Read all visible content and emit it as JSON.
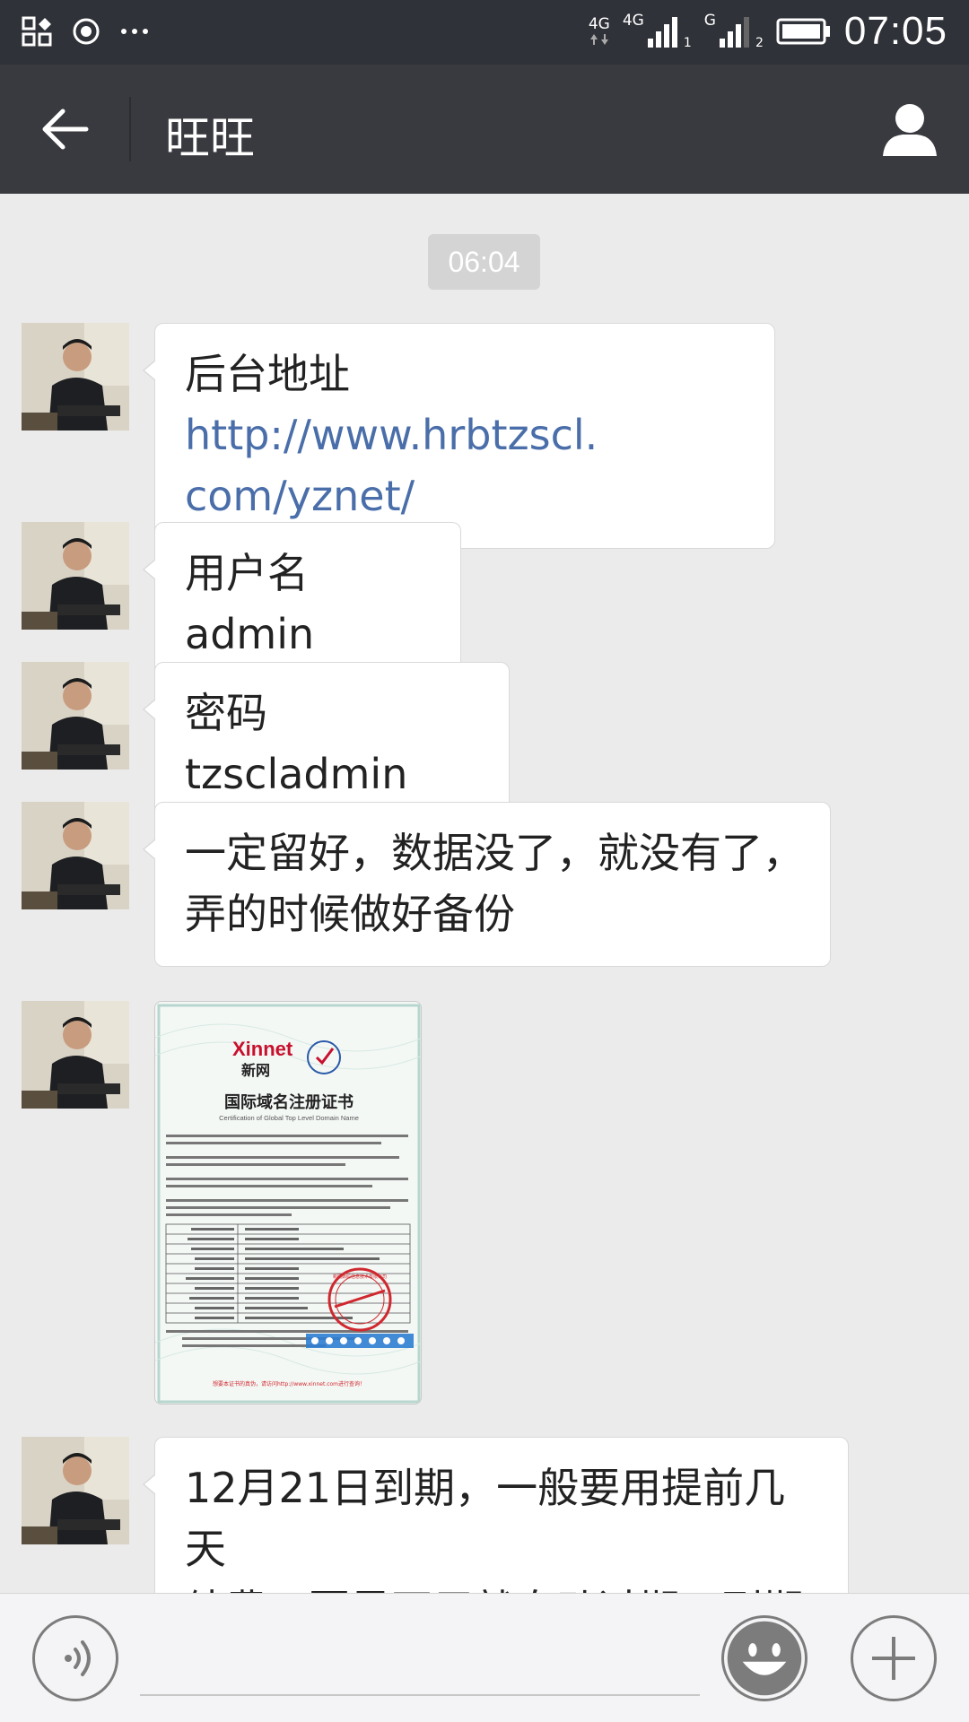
{
  "status_bar": {
    "network_1": "4G",
    "network_2": "4G",
    "sim1_index": "1",
    "network_3": "G",
    "sim2_index": "2",
    "time": "07:05"
  },
  "header": {
    "title": "旺旺"
  },
  "chat": {
    "timestamp": "06:04",
    "messages": [
      {
        "prefix": "后台地址",
        "link": "http://www.hrbtzscl.",
        "link2": "com/yznet/"
      },
      {
        "text": "用户名admin"
      },
      {
        "text": "密码tzscladmin"
      },
      {
        "line1": "一定留好，数据没了，就没有了，",
        "line2": "弄的时候做好备份"
      },
      {
        "image": {
          "brand": "Xinnet",
          "brand_cn": "新网",
          "cert_title": "国际域名注册证书",
          "cert_subtitle": "Certification of Global Top Level Domain Name",
          "stamp_text": "新网数码信息技术有限公司",
          "footer": "想要本证书的真伪，请访问http://www.xinnet.com进行查询！"
        }
      },
      {
        "line1": "12月21日到期，一般要用提前几天",
        "line2": "续费，要是不用就自动过期，到期"
      }
    ]
  },
  "colors": {
    "status_bar_bg": "#2f3238",
    "title_bar_bg": "#393a3f",
    "chat_bg": "#ebebeb",
    "link": "#4a6ea9"
  }
}
